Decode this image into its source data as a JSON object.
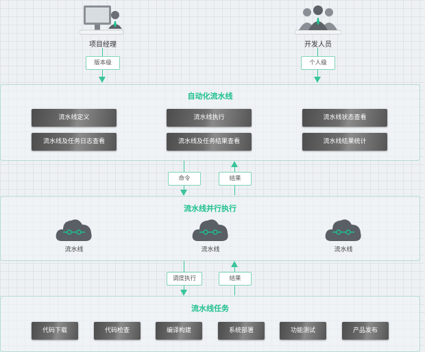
{
  "actors": [
    {
      "id": "pm",
      "label": "项目经理",
      "tag": "版本级"
    },
    {
      "id": "dev",
      "label": "开发人员",
      "tag": "个人级"
    }
  ],
  "panels": {
    "automation": {
      "title": "自动化流水线",
      "buttons": [
        "流水线定义",
        "流水线执行",
        "流水线状态查看",
        "流水线及任务日志查看",
        "流水线及任务结果查看",
        "流水线结果统计"
      ]
    },
    "parallel": {
      "title": "流水线并行执行",
      "clouds": [
        "流水线",
        "流水线",
        "流水线"
      ]
    },
    "tasks": {
      "title": "流水线任务",
      "buttons": [
        "代码下载",
        "代码检查",
        "编译构建",
        "系统部署",
        "功能测试",
        "产品发布"
      ]
    }
  },
  "connectors": {
    "upper": {
      "down": "命令",
      "up": "结果"
    },
    "lower": {
      "down": "调度执行",
      "up": "结果"
    }
  },
  "colors": {
    "accent": "#1fc08e",
    "line": "#38c49a",
    "button": "#5a5a5a"
  }
}
